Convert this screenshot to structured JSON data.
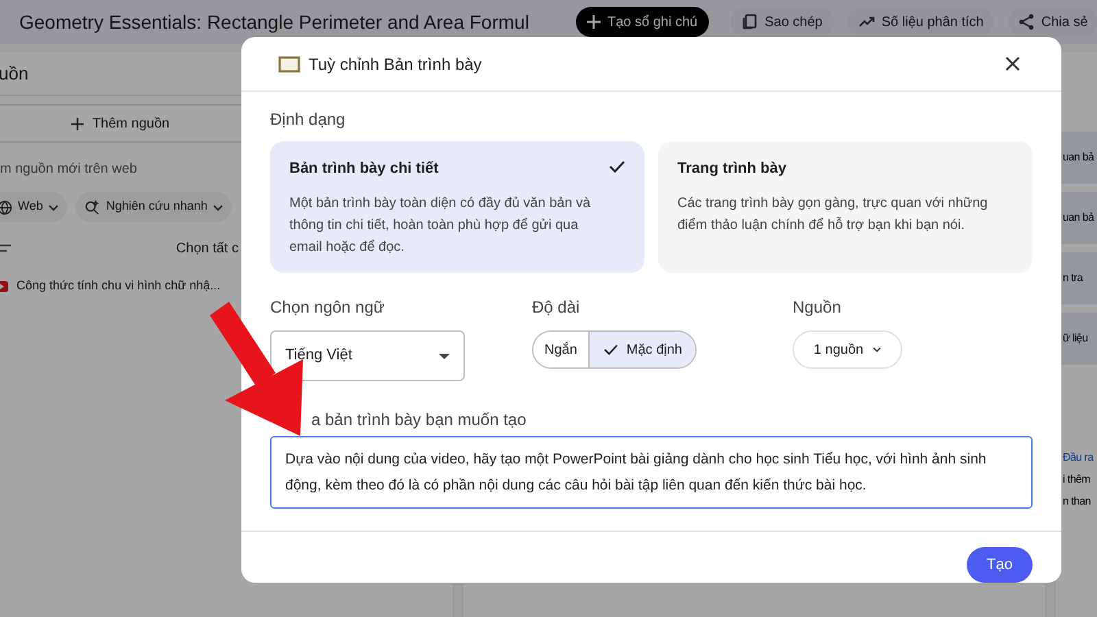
{
  "top_bar": {
    "title": "Geometry Essentials: Rectangle Perimeter and Area Formul",
    "buttons": [
      {
        "label": "Tạo sổ ghi chú",
        "kind": "primary"
      },
      {
        "label": "Sao chép",
        "kind": "copy"
      },
      {
        "label": "Số liệu phân tích",
        "kind": "analytics"
      },
      {
        "label": "Chia sẻ",
        "kind": "share"
      }
    ]
  },
  "sources_panel": {
    "heading": "uồn",
    "add_button": "Thêm nguồn",
    "search_hint": "m nguồn mới trên web",
    "filters": [
      "Web",
      "Nghiên cứu nhanh"
    ],
    "select_all": "Chọn tất c",
    "sources": [
      {
        "title": "Công thức tính chu vi hình chữ nhậ..."
      }
    ]
  },
  "studio_panel": {
    "tiles": [
      {
        "text": "uan bả"
      },
      {
        "text": "uan bả"
      },
      {
        "text": "n tra"
      },
      {
        "text": "ữ liệu"
      }
    ],
    "note_link": "Đầu ra",
    "note_lines": [
      "i thêm",
      "n than"
    ]
  },
  "dialog": {
    "title": "Tuỳ chỉnh Bản trình bày",
    "format_label": "Định dạng",
    "formats": [
      {
        "title": "Bản trình bày chi tiết",
        "description": "Một bản trình bày toàn diện có đầy đủ văn bản và thông tin chi tiết, hoàn toàn phù hợp để gửi qua email hoặc để đọc.",
        "selected": true
      },
      {
        "title": "Trang trình bày",
        "description": "Các trang trình bày gọn gàng, trực quan với những điểm thảo luận chính để hỗ trợ bạn khi bạn nói.",
        "selected": false
      }
    ],
    "language": {
      "label": "Chọn ngôn ngữ",
      "value": "Tiếng Việt"
    },
    "length": {
      "label": "Độ dài",
      "options": [
        {
          "label": "Ngắn",
          "selected": false
        },
        {
          "label": "Mặc định",
          "selected": true
        }
      ]
    },
    "sources": {
      "label": "Nguồn",
      "value": "1 nguồn"
    },
    "prompt": {
      "label": "a bản trình bày bạn muốn tạo",
      "value": "Dựa vào nội dung của video, hãy tạo một PowerPoint bài giảng dành cho học sinh Tiểu học, với hình ảnh sinh động, kèm theo đó là có phần nội dung các câu hỏi bài tập liên quan đến kiến thức bài học."
    },
    "create_button": "Tạo"
  }
}
